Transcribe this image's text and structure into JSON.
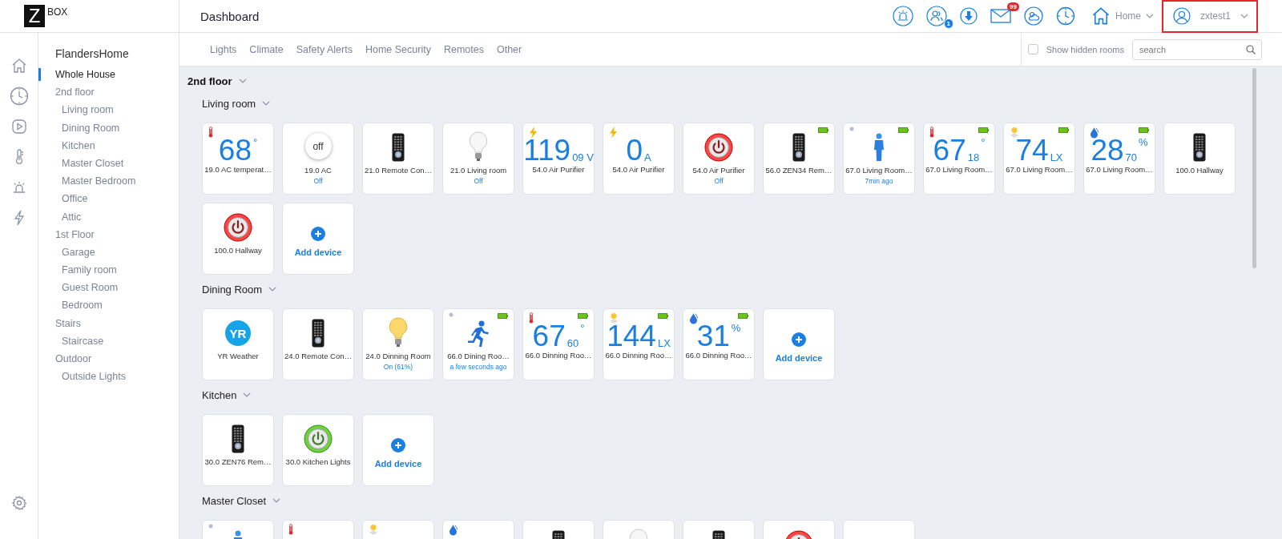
{
  "header": {
    "logo": {
      "mark": "Z",
      "text": "BOX"
    },
    "title": "Dashboard",
    "icons": [
      {
        "kind": "alarm"
      },
      {
        "kind": "users",
        "badge": "1"
      },
      {
        "kind": "download"
      },
      {
        "kind": "mail",
        "badge": "99"
      },
      {
        "kind": "weather"
      },
      {
        "kind": "clock"
      }
    ],
    "home_menu": {
      "label": "Home"
    },
    "user_menu": {
      "label": "zxtest1",
      "highlighted": true
    }
  },
  "rail": {
    "items": [
      {
        "kind": "home"
      },
      {
        "kind": "clock"
      },
      {
        "kind": "play"
      },
      {
        "kind": "thermometer"
      },
      {
        "kind": "alarm"
      },
      {
        "kind": "bolt"
      }
    ],
    "bottom": {
      "kind": "settings"
    }
  },
  "sidebar": {
    "title": "FlandersHome",
    "items": [
      {
        "label": "Whole House",
        "selected": true
      },
      {
        "label": "2nd floor",
        "selected": false,
        "children": [
          {
            "label": "Living room",
            "selected": false
          },
          {
            "label": "Dining Room",
            "selected": false
          },
          {
            "label": "Kitchen",
            "selected": false
          },
          {
            "label": "Master Closet",
            "selected": false
          },
          {
            "label": "Master Bedroom",
            "selected": false
          },
          {
            "label": "Office",
            "selected": false
          },
          {
            "label": "Attic",
            "selected": false
          }
        ]
      },
      {
        "label": "1st Floor",
        "selected": false,
        "children": [
          {
            "label": "Garage",
            "selected": false
          },
          {
            "label": "Family room",
            "selected": false
          },
          {
            "label": "Guest Room",
            "selected": false
          },
          {
            "label": "Bedroom",
            "selected": false
          }
        ]
      },
      {
        "label": "Stairs",
        "selected": false,
        "children": [
          {
            "label": "Staircase",
            "selected": false
          }
        ]
      },
      {
        "label": "Outdoor",
        "selected": false,
        "children": [
          {
            "label": "Outside Lights",
            "selected": false
          }
        ]
      }
    ]
  },
  "filter_tabs": [
    "Lights",
    "Climate",
    "Safety Alerts",
    "Home Security",
    "Remotes",
    "Other"
  ],
  "show_hidden_rooms": {
    "label": "Show hidden rooms",
    "checked": false
  },
  "search": {
    "placeholder": "search"
  },
  "floor": {
    "label": "2nd floor",
    "rooms": [
      {
        "name": "Living room",
        "devices": [
          {
            "kind": "temperature",
            "battery": false,
            "value": "68",
            "unit_high": "°",
            "name": "19.0 AC temperat…"
          },
          {
            "kind": "switch",
            "switch_text": "off",
            "name": "19.0 AC",
            "status": "Off"
          },
          {
            "kind": "remote",
            "name": "21.0 Remote Con…"
          },
          {
            "kind": "bulb",
            "on": false,
            "name": "21.0 Living room",
            "status": "Off"
          },
          {
            "kind": "energy",
            "battery": false,
            "value": "119",
            "unit_low": "09 V",
            "name": "54.0 Air Purifier"
          },
          {
            "kind": "energy",
            "battery": false,
            "value": "0",
            "unit_low": "A",
            "name": "54.0 Air Purifier"
          },
          {
            "kind": "power",
            "on": false,
            "name": "54.0 Air Purifier",
            "status": "Off"
          },
          {
            "kind": "remote",
            "battery": true,
            "name": "56.0 ZEN34 Rem…"
          },
          {
            "kind": "presence",
            "battery": true,
            "name": "67.0 Living Room…",
            "status": "7min ago"
          },
          {
            "kind": "temperature",
            "battery": true,
            "value": "67",
            "unit_low": "18",
            "unit_high": "°",
            "name": "67.0 Living Room…"
          },
          {
            "kind": "illuminance",
            "battery": true,
            "value": "74",
            "unit_low": "LX",
            "name": "67.0 Living Room…"
          },
          {
            "kind": "humidity",
            "battery": true,
            "value": "28",
            "unit_low": "70",
            "unit_high": "%",
            "name": "67.0 Living Room…"
          },
          {
            "kind": "remote",
            "name": "100.0 Hallway"
          },
          {
            "kind": "power",
            "on": false,
            "name": "100.0 Hallway"
          },
          {
            "kind": "add",
            "label": "Add device"
          }
        ]
      },
      {
        "name": "Dining Room",
        "devices": [
          {
            "kind": "weather",
            "logo_text": "YR",
            "name": "YR Weather"
          },
          {
            "kind": "remote",
            "name": "24.0 Remote Con…"
          },
          {
            "kind": "bulb",
            "on": true,
            "name": "24.0 Dinning Room",
            "status": "On (61%)"
          },
          {
            "kind": "motion",
            "battery": true,
            "name": "66.0 Dining Roo…",
            "status": "a few seconds ago"
          },
          {
            "kind": "temperature",
            "battery": true,
            "value": "67",
            "unit_low": "60",
            "unit_high": "°",
            "name": "66.0 Dinning Roo…"
          },
          {
            "kind": "illuminance",
            "battery": true,
            "value": "144",
            "unit_low": "LX",
            "name": "66.0 Dinning Roo…"
          },
          {
            "kind": "humidity",
            "battery": true,
            "value": "31",
            "unit_high": "%",
            "name": "66.0 Dinning Roo…"
          },
          {
            "kind": "add",
            "label": "Add device"
          }
        ]
      },
      {
        "name": "Kitchen",
        "devices": [
          {
            "kind": "remote",
            "name": "30.0 ZEN76 Rem…"
          },
          {
            "kind": "power",
            "on": true,
            "name": "30.0 Kitchen Lights"
          },
          {
            "kind": "add",
            "label": "Add device"
          }
        ]
      },
      {
        "name": "Master Closet",
        "devices": [
          {
            "kind": "presence"
          },
          {
            "kind": "temperature"
          },
          {
            "kind": "illuminance"
          },
          {
            "kind": "humidity"
          },
          {
            "kind": "remote"
          },
          {
            "kind": "bulb",
            "on": false
          },
          {
            "kind": "remote"
          },
          {
            "kind": "power",
            "on": false
          },
          {
            "kind": "empty"
          }
        ]
      }
    ]
  }
}
